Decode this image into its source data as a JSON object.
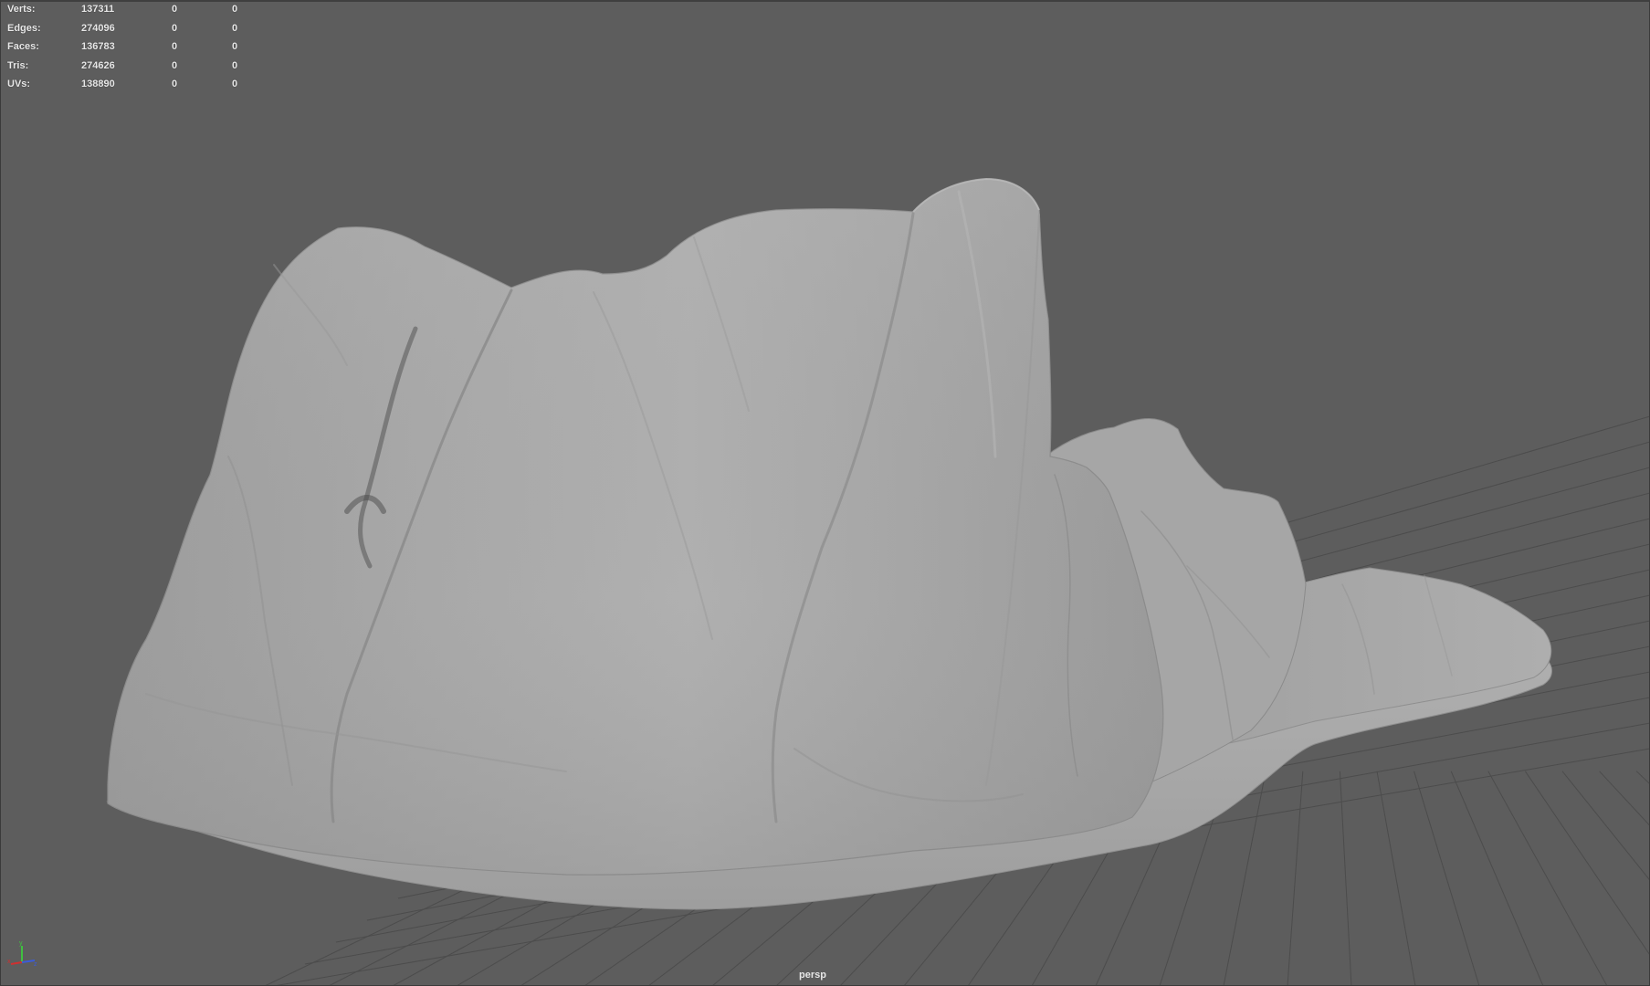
{
  "viewport": {
    "camera_label": "persp",
    "background_color": "#5d5d5d",
    "grid_color": "#4a4a4a",
    "mesh_color": "#a9a9a9"
  },
  "poly_count": {
    "rows": [
      {
        "label": "Verts:",
        "count": "137311",
        "selected": "0",
        "components": "0"
      },
      {
        "label": "Edges:",
        "count": "274096",
        "selected": "0",
        "components": "0"
      },
      {
        "label": "Faces:",
        "count": "136783",
        "selected": "0",
        "components": "0"
      },
      {
        "label": "Tris:",
        "count": "274626",
        "selected": "0",
        "components": "0"
      },
      {
        "label": "UVs:",
        "count": "138890",
        "selected": "0",
        "components": "0"
      }
    ]
  },
  "axis_gizmo": {
    "icon": "xyz-axis-icon",
    "x_color": "#d03030",
    "y_color": "#40c040",
    "z_color": "#3c5cd8"
  }
}
